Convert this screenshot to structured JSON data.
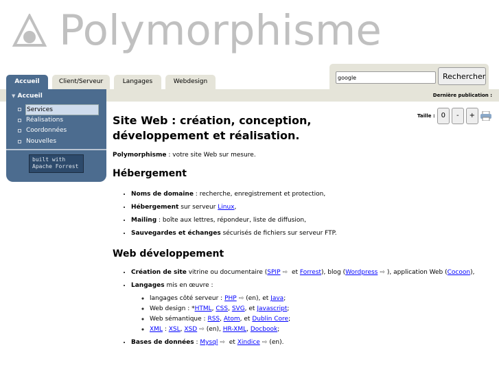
{
  "logo": {
    "text": "Polymorphisme"
  },
  "tabs": [
    {
      "label": "Accueil"
    },
    {
      "label": "Client/Serveur"
    },
    {
      "label": "Langages"
    },
    {
      "label": "Webdesign"
    }
  ],
  "search": {
    "value": "google",
    "button": "Rechercher"
  },
  "last_publication": "Dernière publication :",
  "sidebar": {
    "heading": "Accueil",
    "items": [
      {
        "label": "Services"
      },
      {
        "label": "Réalisations"
      },
      {
        "label": "Coordonnées"
      },
      {
        "label": "Nouvelles"
      }
    ],
    "badge": "built with Apache Forrest"
  },
  "size": {
    "label": "Taille :",
    "reset": "0",
    "minus": "-",
    "plus": "+"
  },
  "content": {
    "title": "Site Web : création, conception, développement et réalisation.",
    "intro_bold": "Polymorphisme",
    "intro_rest": " : votre site Web sur mesure.",
    "h_hosting": "Hébergement",
    "hosting": [
      {
        "b": "Noms de domaine",
        "t": " : recherche, enregistrement et protection,"
      },
      {
        "b": "Hébergement",
        "t": " sur serveur ",
        "link": "Linux",
        "t2": ","
      },
      {
        "b": "Mailing",
        "t": " : boîte aux lettres, répondeur, liste de diffusion,"
      },
      {
        "b": "Sauvegardes et échanges",
        "t": " sécurisés de fichiers sur serveur FTP."
      }
    ],
    "h_dev": "Web développement",
    "dev": {
      "site_b": "Création de site",
      "site_t1": " vitrine ou documentaire (",
      "spip": "SPIP",
      "et": " et ",
      "forrest": "Forrest",
      "site_t2": "), blog (",
      "wordpress": "Wordpress",
      "site_t3": "), application Web (",
      "cocoon": "Cocoon",
      "site_t4": "),",
      "lang_b": "Langages",
      "lang_t": " mis en œuvre :",
      "sub1_t": "langages côté serveur : ",
      "php": "PHP",
      "sub1_t2": "(en), et ",
      "java": "Java",
      "semi": ";",
      "sub2_t": "Web design : *",
      "html": "HTML",
      "css": "CSS",
      "svg": "SVG",
      "sub2_t2": ", et ",
      "javascript": "Javascript",
      "sub3_t": "Web sémantique : ",
      "rss": "RSS",
      "atom": "Atom",
      "sub3_t2": ", et ",
      "dublin": "Dublin Core",
      "xml": "XML",
      "xsl": "XSL",
      "xsd": "XSD",
      "sub4_t": "(en), ",
      "hrxml": "HR-XML",
      "docbook": "Docbook",
      "db_b": "Bases de données",
      "db_t": " : ",
      "mysql": "Mysql",
      "xindice": "Xindice",
      "db_t2": "(en).",
      "ext": "⇨",
      "comma": ", ",
      "colon": " : "
    }
  }
}
